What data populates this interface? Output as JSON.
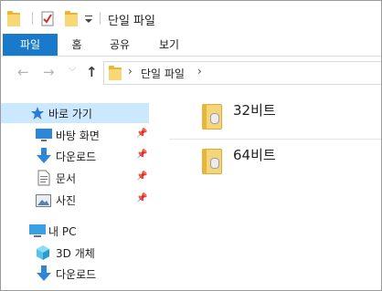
{
  "window": {
    "title": "단일 파일"
  },
  "ribbon": {
    "tabs": [
      {
        "label": "파일",
        "active": true
      },
      {
        "label": "홈"
      },
      {
        "label": "공유"
      },
      {
        "label": "보기"
      }
    ]
  },
  "nav": {
    "back_glyph": "←",
    "forward_glyph": "→",
    "recent_glyph": "⌵",
    "up_glyph": "↑",
    "breadcrumb": [
      "단일 파일"
    ],
    "chevron": "›"
  },
  "sidebar": {
    "pin_glyph": "📌",
    "items": [
      {
        "label": "바로 가기",
        "icon": "star-icon",
        "selected": true
      },
      {
        "label": "바탕 화면",
        "icon": "desktop-icon",
        "pinned": true
      },
      {
        "label": "다운로드",
        "icon": "download-icon",
        "pinned": true
      },
      {
        "label": "문서",
        "icon": "document-icon",
        "pinned": true
      },
      {
        "label": "사진",
        "icon": "pictures-icon",
        "pinned": true
      },
      {
        "label": "내 PC",
        "icon": "pc-icon"
      },
      {
        "label": "3D 개체",
        "icon": "3d-objects-icon"
      },
      {
        "label": "다운로드",
        "icon": "download-icon"
      }
    ]
  },
  "files": [
    {
      "name": "32비트",
      "icon": "zip-folder-icon"
    },
    {
      "name": "64비트",
      "icon": "zip-folder-icon"
    }
  ],
  "colors": {
    "accent": "#1979ca",
    "selection": "#cce8ff",
    "folder": "#f8d775",
    "star": "#2d7bd6"
  }
}
